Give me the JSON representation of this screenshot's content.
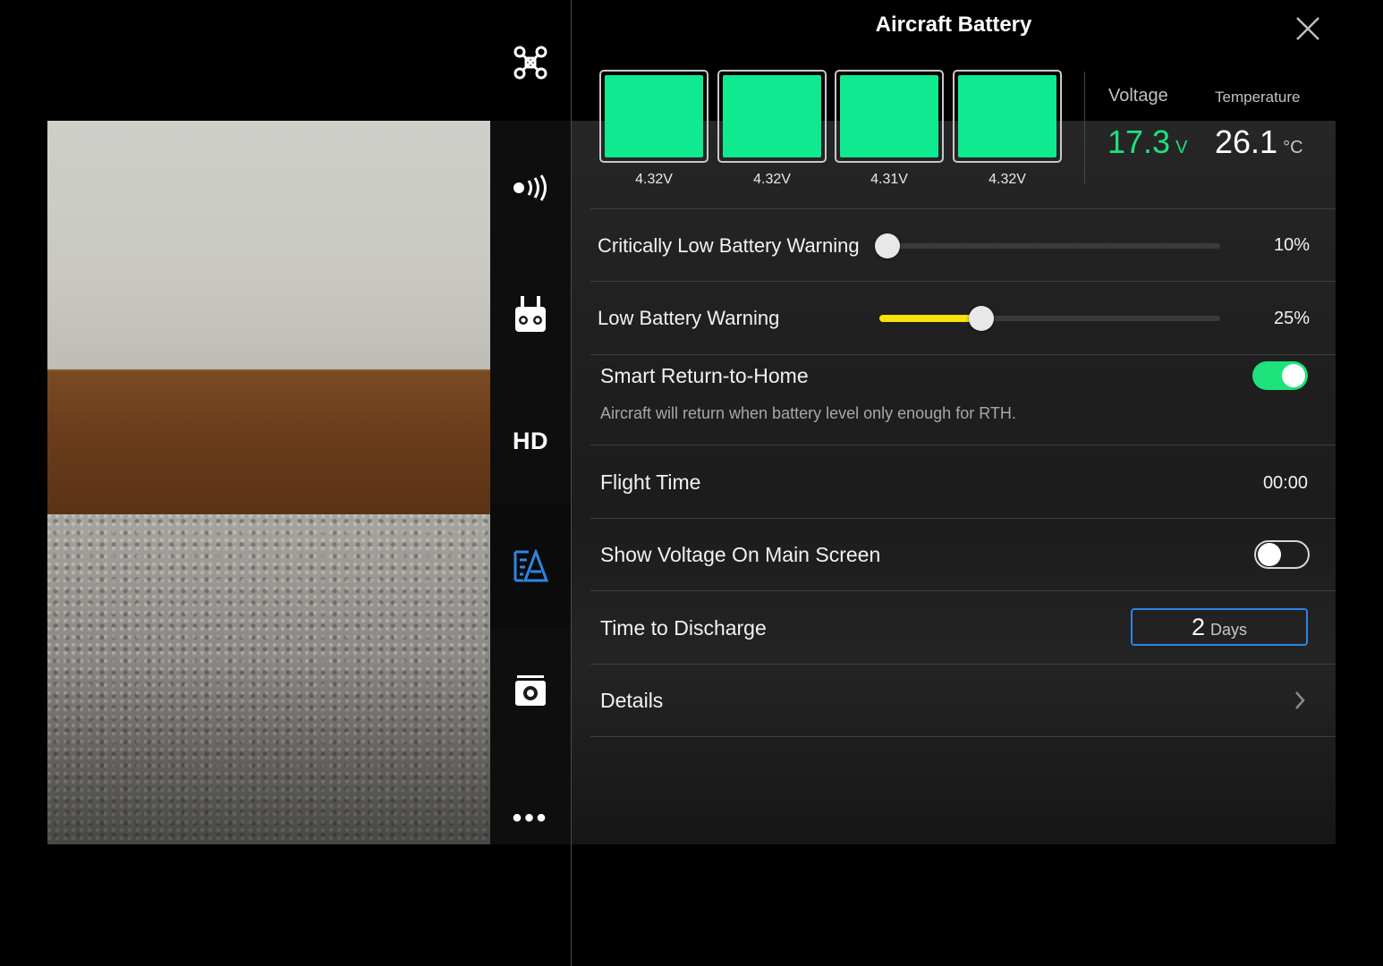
{
  "panel": {
    "title": "Aircraft Battery"
  },
  "battery": {
    "cells": [
      {
        "voltage": "4.32V",
        "level": 1.0
      },
      {
        "voltage": "4.32V",
        "level": 1.0
      },
      {
        "voltage": "4.31V",
        "level": 1.0
      },
      {
        "voltage": "4.32V",
        "level": 1.0
      }
    ],
    "voltage_label": "Voltage",
    "voltage_value": "17.3",
    "voltage_unit": "V",
    "temperature_label": "Temperature",
    "temperature_value": "26.1",
    "temperature_unit": "°C"
  },
  "settings": {
    "critical_low": {
      "label": "Critically Low Battery Warning",
      "value": "10%",
      "percent": 10
    },
    "low_warning": {
      "label": "Low Battery Warning",
      "value": "25%",
      "percent": 25
    },
    "smart_rth": {
      "label": "Smart Return-to-Home",
      "description": "Aircraft will return when battery level only enough for RTH.",
      "enabled": true
    },
    "flight_time": {
      "label": "Flight Time",
      "value": "00:00"
    },
    "show_voltage": {
      "label": "Show Voltage On Main Screen",
      "enabled": false
    },
    "time_to_discharge": {
      "label": "Time to Discharge",
      "value": "2",
      "unit": "Days"
    },
    "details": {
      "label": "Details"
    }
  },
  "sidebar": {
    "items": [
      {
        "name": "aircraft",
        "icon": "drone-icon"
      },
      {
        "name": "signal",
        "icon": "signal-icon"
      },
      {
        "name": "remote-controller",
        "icon": "remote-controller-icon"
      },
      {
        "name": "hd-transmission",
        "icon": "hd-icon",
        "label": "HD"
      },
      {
        "name": "battery",
        "icon": "battery-settings-icon",
        "active": true
      },
      {
        "name": "camera",
        "icon": "camera-icon"
      },
      {
        "name": "more",
        "icon": "more-icon",
        "label": "•••"
      }
    ]
  },
  "colors": {
    "cell_fill": "#0fe98f",
    "voltage_accent": "#1ee27c",
    "slider_yellow": "#f5e20a",
    "active_blue": "#2d86e0"
  }
}
